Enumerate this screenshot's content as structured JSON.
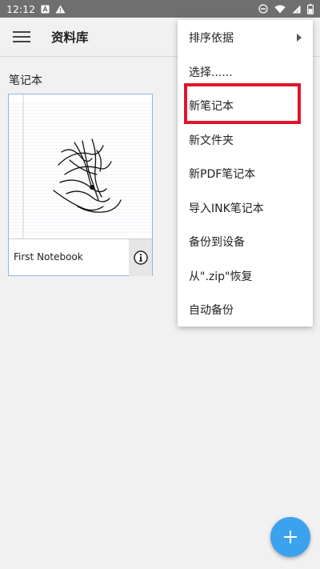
{
  "status_bar": {
    "time": "12:12",
    "icons": [
      "notification-a-icon",
      "warning-icon",
      "do-not-disturb-icon",
      "wifi-icon",
      "signal-icon",
      "battery-icon"
    ]
  },
  "app_bar": {
    "title": "资料库",
    "menu_icon": "hamburger-menu-icon"
  },
  "library": {
    "section_title": "笔记本",
    "notebooks": [
      {
        "name": "First Notebook",
        "info_icon": "info-icon"
      }
    ]
  },
  "dropdown_menu": {
    "items": [
      {
        "label": "排序依据",
        "has_submenu": true
      },
      {
        "label": "选择......"
      },
      {
        "label": "新笔记本",
        "highlighted": true
      },
      {
        "label": "新文件夹"
      },
      {
        "label": "新PDF笔记本"
      },
      {
        "label": "导入INK笔记本"
      },
      {
        "label": "备份到设备"
      },
      {
        "label": "从\".zip\"恢复"
      },
      {
        "label": "自动备份"
      }
    ]
  },
  "fab": {
    "icon": "plus-icon"
  },
  "colors": {
    "status_bar": "#6f6f6f",
    "background": "#f1f1f1",
    "card_border": "#8fb6e3",
    "highlight": "#e0142a",
    "fab": "#3da2ee"
  }
}
